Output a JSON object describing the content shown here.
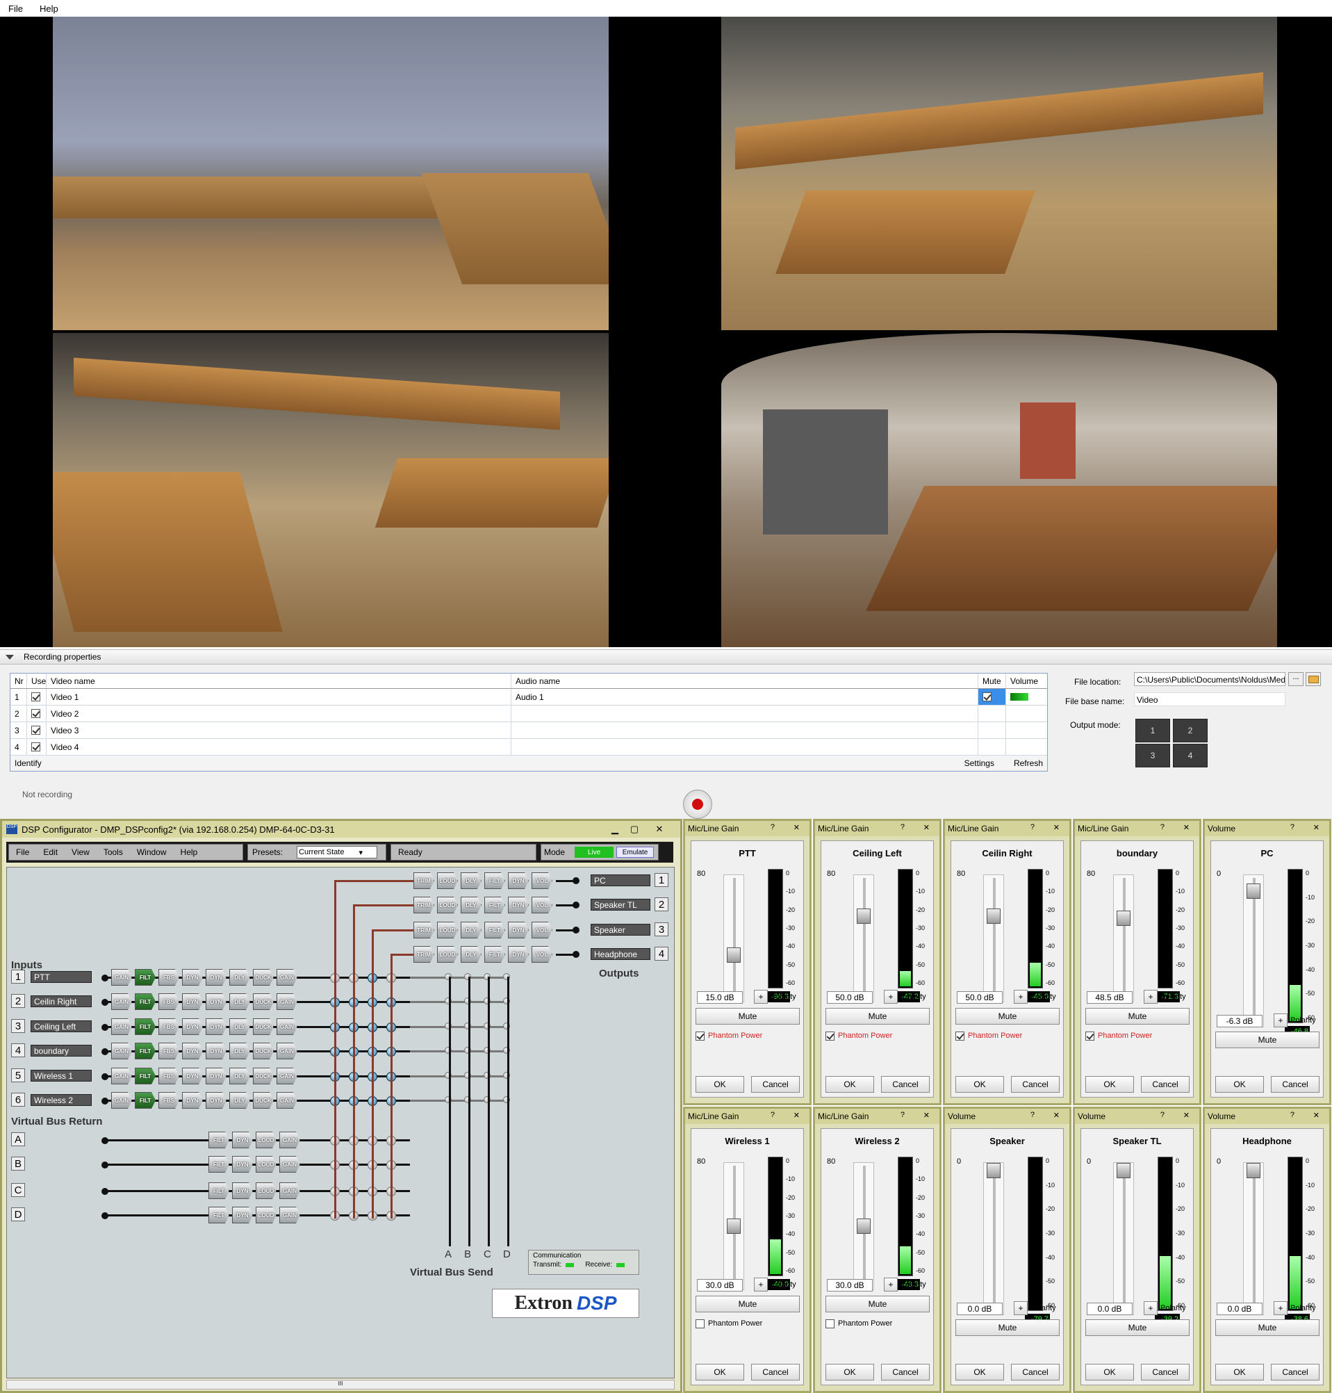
{
  "menu": {
    "file": "File",
    "help": "Help"
  },
  "recording": {
    "header": "Recording properties",
    "columns": {
      "nr": "Nr",
      "use": "Use",
      "video": "Video name",
      "audio": "Audio name",
      "mute": "Mute",
      "volume": "Volume"
    },
    "rows": [
      {
        "nr": "1",
        "video": "Video 1",
        "audio": "Audio 1"
      },
      {
        "nr": "2",
        "video": "Video 2",
        "audio": ""
      },
      {
        "nr": "3",
        "video": "Video 3",
        "audio": ""
      },
      {
        "nr": "4",
        "video": "Video 4",
        "audio": ""
      }
    ],
    "footer": {
      "identify": "Identify",
      "settings": "Settings",
      "refresh": "Refresh"
    },
    "file_location_label": "File location:",
    "file_location_value": "C:\\Users\\Public\\Documents\\Noldus\\Medi",
    "browse_label": "...",
    "file_base_label": "File base name:",
    "file_base_value": "Video",
    "output_mode_label": "Output mode:",
    "output_modes": [
      "1",
      "2",
      "3",
      "4"
    ],
    "status": "Not recording"
  },
  "dsp": {
    "title": "DSP Configurator - DMP_DSPconfig2* (via 192.168.0.254) DMP-64-0C-D3-31",
    "menu": [
      "File",
      "Edit",
      "View",
      "Tools",
      "Window",
      "Help"
    ],
    "presets_label": "Presets:",
    "presets_value": "Current State",
    "status": "Ready",
    "mode_label": "Mode",
    "mode_live": "Live",
    "mode_emulate": "Emulate",
    "inputs_label": "Inputs",
    "inputs": [
      {
        "n": "1",
        "name": "PTT"
      },
      {
        "n": "2",
        "name": "Ceilin Right"
      },
      {
        "n": "3",
        "name": "Ceiling Left"
      },
      {
        "n": "4",
        "name": "boundary"
      },
      {
        "n": "5",
        "name": "Wireless 1"
      },
      {
        "n": "6",
        "name": "Wireless 2"
      }
    ],
    "input_blocks": [
      "GAIN",
      "FILT",
      "FBS",
      "DYN",
      "DYN",
      "DLY",
      "DUCK",
      "GAIN"
    ],
    "vbr_label": "Virtual Bus Return",
    "vbr": [
      "A",
      "B",
      "C",
      "D"
    ],
    "vbr_blocks": [
      "FILT",
      "DYN",
      "LOUD",
      "GAIN"
    ],
    "outputs_label": "Outputs",
    "outputs": [
      {
        "n": "1",
        "name": "PC"
      },
      {
        "n": "2",
        "name": "Speaker TL"
      },
      {
        "n": "3",
        "name": "Speaker"
      },
      {
        "n": "4",
        "name": "Headphone"
      }
    ],
    "output_blocks": [
      "TRIM",
      "LOUD",
      "DLY",
      "FILT",
      "DYN",
      "VOL"
    ],
    "vbs_label": "Virtual Bus Send",
    "vbs": [
      "A",
      "B",
      "C",
      "D"
    ],
    "comm_label": "Communication",
    "transmit": "Transmit:",
    "receive": "Receive:",
    "logo_a": "Extron",
    "logo_b": "DSP",
    "scroll_glyph": "III"
  },
  "panels": [
    {
      "title": "Mic/Line Gain",
      "name": "PTT",
      "top": "80",
      "bottom": "-18",
      "meter": "-96.3",
      "level": 0,
      "thumb": 0.65,
      "gain": "15.0 dB",
      "phantom": true
    },
    {
      "title": "Mic/Line Gain",
      "name": "Ceiling Left",
      "top": "80",
      "bottom": "-18",
      "meter": "-47.2",
      "level": 0.13,
      "thumb": 0.3,
      "gain": "50.0 dB",
      "phantom": true
    },
    {
      "title": "Mic/Line Gain",
      "name": "Ceilin Right",
      "top": "80",
      "bottom": "-18",
      "meter": "-45.0",
      "level": 0.2,
      "thumb": 0.3,
      "gain": "50.0 dB",
      "phantom": true
    },
    {
      "title": "Mic/Line Gain",
      "name": "boundary",
      "top": "80",
      "bottom": "-18",
      "meter": "-71.3",
      "level": 0,
      "thumb": 0.32,
      "gain": "48.5 dB",
      "phantom": true
    },
    {
      "title": "Volume",
      "name": "PC",
      "top": "0",
      "bottom": "-100",
      "meter": "-46.8",
      "level": 0.24,
      "thumb": 0.06,
      "gain": "-6.3 dB",
      "phantom": null
    },
    {
      "title": "Mic/Line Gain",
      "name": "Wireless  1",
      "top": "80",
      "bottom": "-18",
      "meter": "-40.0",
      "level": 0.3,
      "thumb": 0.5,
      "gain": "30.0 dB",
      "phantom": false
    },
    {
      "title": "Mic/Line Gain",
      "name": "Wireless  2",
      "top": "80",
      "bottom": "-18",
      "meter": "-43.3",
      "level": 0.24,
      "thumb": 0.5,
      "gain": "30.0 dB",
      "phantom": false
    },
    {
      "title": "Volume",
      "name": "Speaker",
      "top": "0",
      "bottom": "-100",
      "meter": "-79.7",
      "level": 0,
      "thumb": 0.0,
      "gain": "0.0 dB",
      "phantom": null
    },
    {
      "title": "Volume",
      "name": "Speaker TL",
      "top": "0",
      "bottom": "-100",
      "meter": "-39.2",
      "level": 0.35,
      "thumb": 0.0,
      "gain": "0.0 dB",
      "phantom": null
    },
    {
      "title": "Volume",
      "name": "Headphone",
      "top": "0",
      "bottom": "-100",
      "meter": "-38.6",
      "level": 0.35,
      "thumb": 0.0,
      "gain": "0.0 dB",
      "phantom": null
    }
  ],
  "panel_text": {
    "polarity": "Polarity",
    "plus": "+",
    "mute": "Mute",
    "phantom": "Phantom Power",
    "ok": "OK",
    "cancel": "Cancel",
    "help": "?",
    "close": "✕"
  },
  "scale_mic": [
    "0",
    "-10",
    "-20",
    "-30",
    "-40",
    "-50",
    "-60"
  ],
  "colors": {
    "phantom_on": "#d02020",
    "meter": "#22cc22",
    "accent": "#d10d0d"
  }
}
